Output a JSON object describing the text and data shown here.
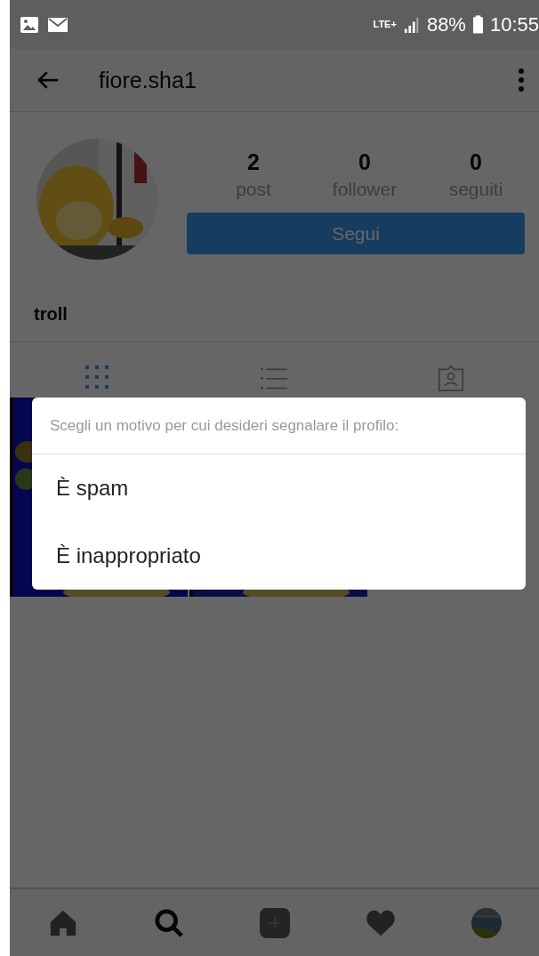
{
  "status_bar": {
    "network": "LTE+",
    "battery": "88%",
    "time": "10:55"
  },
  "app_bar": {
    "title": "fiore.sha1"
  },
  "profile": {
    "stats": [
      {
        "value": "2",
        "label": "post"
      },
      {
        "value": "0",
        "label": "follower"
      },
      {
        "value": "0",
        "label": "seguiti"
      }
    ],
    "follow_button": "Segui",
    "name": "troll"
  },
  "tabs": [
    {
      "kind": "grid",
      "selected": true
    },
    {
      "kind": "list",
      "selected": false
    },
    {
      "kind": "tagged",
      "selected": false
    }
  ],
  "dialog": {
    "title": "Scegli un motivo per cui desideri segnalare il profilo:",
    "options": [
      "È spam",
      "È inappropriato"
    ]
  },
  "bottom_nav": [
    {
      "kind": "home",
      "selected": false
    },
    {
      "kind": "search",
      "selected": true
    },
    {
      "kind": "add",
      "selected": false
    },
    {
      "kind": "heart",
      "selected": false
    },
    {
      "kind": "profile",
      "selected": false
    }
  ]
}
